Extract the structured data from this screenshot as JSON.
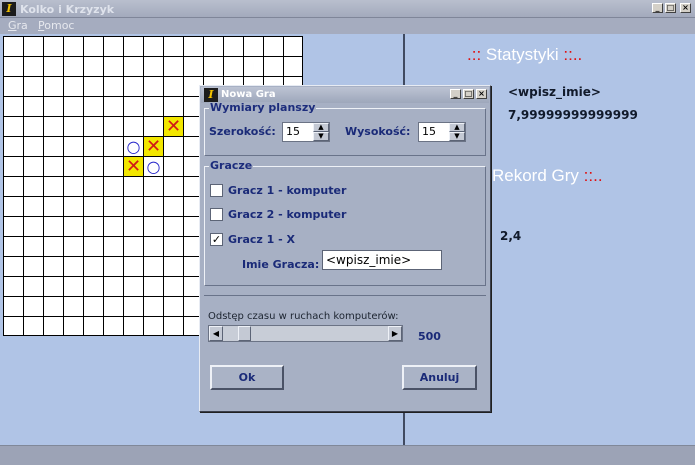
{
  "window": {
    "title": "Kolko i Krzyzyk",
    "icon": "app-logo-icon"
  },
  "menu": {
    "items": [
      "Gra",
      "Pomoc"
    ]
  },
  "board": {
    "cols": 15,
    "rows": 15,
    "cells": [
      {
        "col": 8,
        "row": 4,
        "mark": "X"
      },
      {
        "col": 6,
        "row": 5,
        "mark": "O"
      },
      {
        "col": 7,
        "row": 5,
        "mark": "X"
      },
      {
        "col": 6,
        "row": 6,
        "mark": "X"
      },
      {
        "col": 7,
        "row": 6,
        "mark": "O"
      }
    ]
  },
  "stats": {
    "heading_left": ".::",
    "heading_word": "Statystyki",
    "heading_right": "::..",
    "player_name": "<wpisz_imie>",
    "player_value": "7,99999999999999",
    "record_word": "Rekord Gry",
    "record_right": "::..",
    "record_value": "2,4"
  },
  "dialog": {
    "title": "Nowa Gra",
    "dims_group": "Wymiary planszy",
    "width_label": "Szerokość:",
    "width_value": "15",
    "height_label": "Wysokość:",
    "height_value": "15",
    "players_group": "Gracze",
    "player1_computer": {
      "label": "Gracz 1 - komputer",
      "checked": false
    },
    "player2_computer": {
      "label": "Gracz 2 - komputer",
      "checked": false
    },
    "player1_x": {
      "label": "Gracz 1 - X",
      "checked": true
    },
    "name_label": "Imie Gracza:",
    "name_value": "<wpisz_imie>",
    "delay_label": "Odstęp czasu w ruchach komputerów:",
    "delay_value": "500",
    "delay_fraction": 0.1,
    "ok_label": "Ok",
    "cancel_label": "Anuluj"
  }
}
